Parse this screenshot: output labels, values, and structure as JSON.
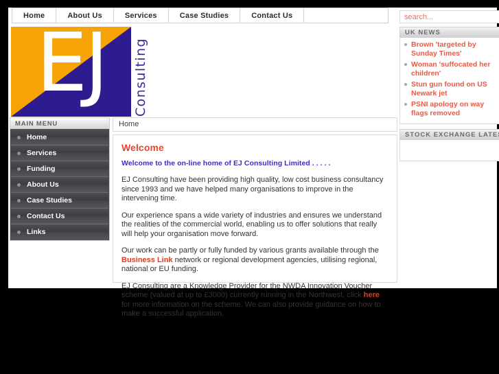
{
  "topnav": {
    "items": [
      {
        "label": "Home"
      },
      {
        "label": "About Us"
      },
      {
        "label": "Services"
      },
      {
        "label": "Case Studies"
      },
      {
        "label": "Contact Us"
      }
    ]
  },
  "search": {
    "placeholder": "search...",
    "value": ""
  },
  "logo": {
    "letters": "EJ",
    "vertical_text": "Consulting",
    "orange": "#f5a306",
    "purple": "#2e1b8f"
  },
  "sidebar": {
    "header": "MAIN MENU",
    "items": [
      {
        "label": "Home"
      },
      {
        "label": "Services"
      },
      {
        "label": "Funding"
      },
      {
        "label": "About Us"
      },
      {
        "label": "Case Studies"
      },
      {
        "label": "Contact Us"
      },
      {
        "label": "Links"
      }
    ]
  },
  "breadcrumb": {
    "text": "Home"
  },
  "main": {
    "heading": "Welcome",
    "lede": "Welcome to the on-line home of EJ Consulting Limited . . . . .",
    "paragraph1": "EJ Consulting have been providing high quality, low cost business consultancy since 1993 and we have helped many organisations to improve in the intervening time.",
    "paragraph2": "Our experience spans a wide variety of industries and ensures we understand the realities of the commercial world, enabling us to offer solutions that really will help your organisation move forward.",
    "paragraph3_before": "Our work can be partly or fully funded by various grants available through the ",
    "paragraph3_link": "Business Link",
    "paragraph3_after": " network or regional development agencies, utilising regional, national or EU funding.",
    "paragraph4_before": "EJ Consulting are a Knowledge Provider for the NWDA Innovation Voucher scheme (valued at up to £3000) currently running in the Northwest, click ",
    "paragraph4_link": "here",
    "paragraph4_after": " for more information on the scheme. We can also provide guidance on how to make a successful application."
  },
  "news": {
    "header": "UK NEWS",
    "items": [
      {
        "headline": "Brown 'targeted by Sunday Times'"
      },
      {
        "headline": "Woman 'suffocated her children'"
      },
      {
        "headline": "Stun gun found on US Newark jet"
      },
      {
        "headline": "PSNI apology on way flags removed"
      }
    ]
  },
  "stock": {
    "header": "STOCK EXCHANGE LATEST"
  },
  "colors": {
    "accent_red": "#e8472b",
    "link_red": "#e03b1c",
    "lede_blue": "#3a2ec0",
    "menu_dark": "#45454a"
  }
}
